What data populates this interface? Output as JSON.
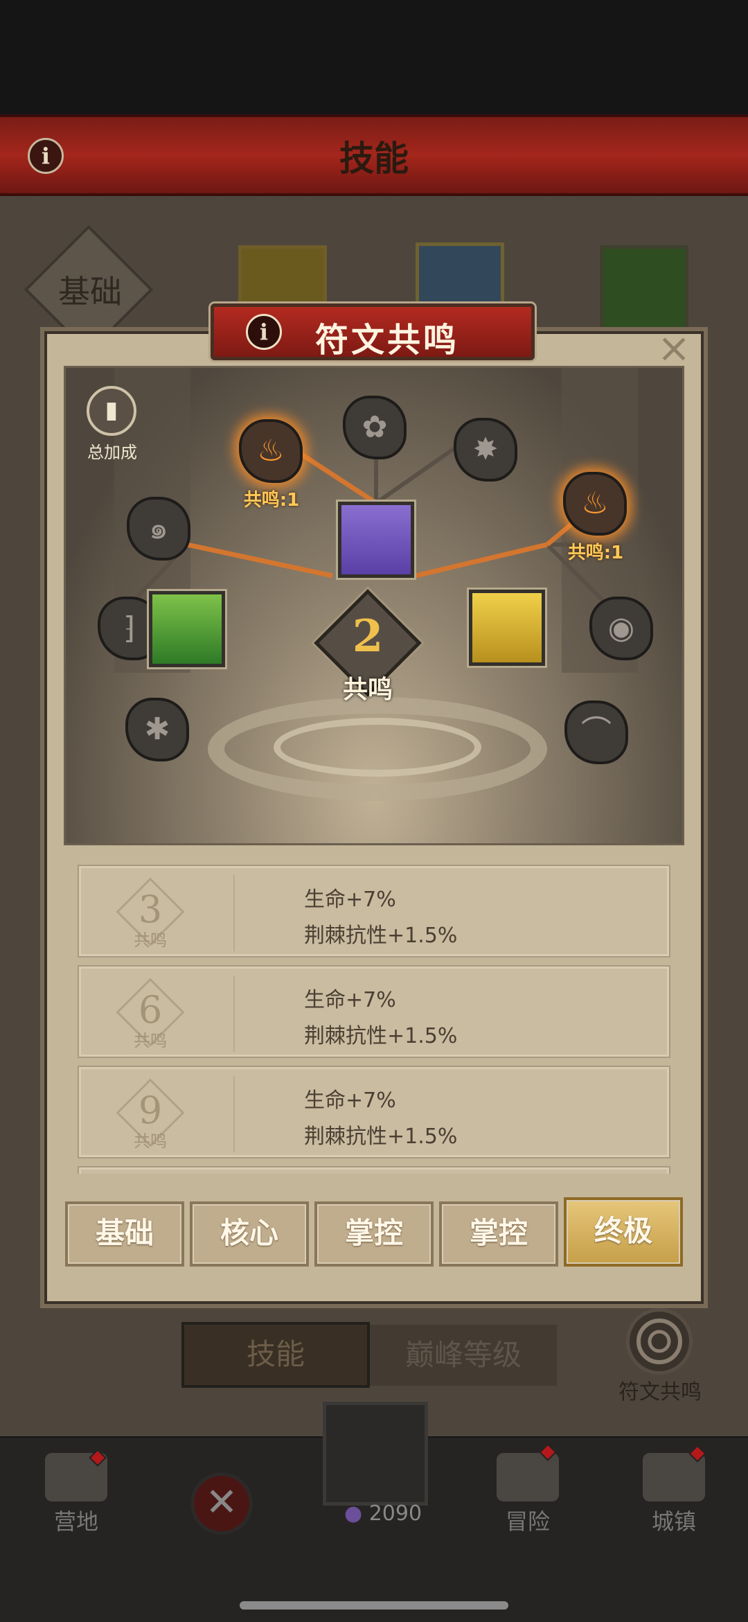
{
  "header": {
    "title": "技能",
    "info_icon": "info-icon"
  },
  "background": {
    "basic_label": "基础",
    "tabs": [
      "技能",
      "巅峰等级"
    ],
    "rune_button_label": "符文共鸣"
  },
  "modal": {
    "title": "符文共鸣",
    "total_bonus_label": "总加成",
    "center": {
      "count": "2",
      "label": "共鸣"
    },
    "resonance_labels": {
      "left": "共鸣:1",
      "right": "共鸣:1"
    },
    "tiers": [
      {
        "level": "3",
        "sub": "共鸣",
        "line1": "生命+7%",
        "line2": "荆棘抗性+1.5%"
      },
      {
        "level": "6",
        "sub": "共鸣",
        "line1": "生命+7%",
        "line2": "荆棘抗性+1.5%"
      },
      {
        "level": "9",
        "sub": "共鸣",
        "line1": "生命+7%",
        "line2": "荆棘抗性+1.5%"
      }
    ],
    "category_tabs": [
      "基础",
      "核心",
      "掌控",
      "掌控",
      "终极"
    ],
    "active_tab_index": 4
  },
  "bottom_nav": {
    "items": [
      {
        "label": "营地",
        "icon": "tent-icon"
      },
      {
        "label": "",
        "icon": "close-icon"
      },
      {
        "label": "2090",
        "icon": "spider-icon"
      },
      {
        "label": "冒险",
        "icon": "map-icon"
      },
      {
        "label": "城镇",
        "icon": "castle-icon"
      }
    ]
  },
  "colors": {
    "accent_red": "#a4261c",
    "glow_orange": "#f08a2a",
    "active_gold": "#d8b464"
  }
}
